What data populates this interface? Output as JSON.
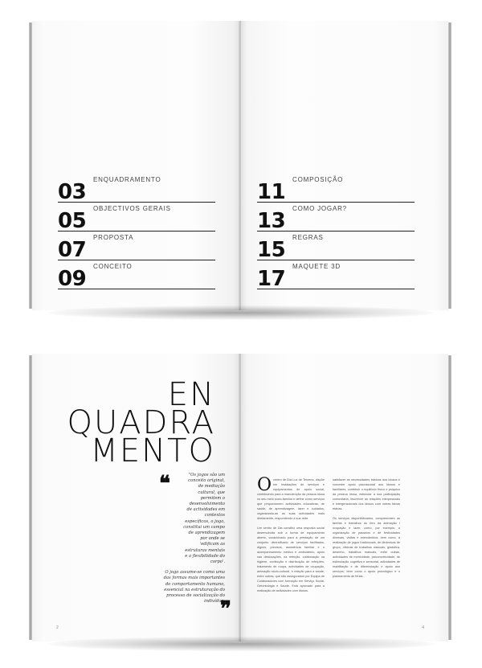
{
  "toc": {
    "left": [
      {
        "num": "03",
        "label": "ENQUADRAMENTO"
      },
      {
        "num": "05",
        "label": "OBJECTIVOS GERAIS"
      },
      {
        "num": "07",
        "label": "PROPOSTA"
      },
      {
        "num": "09",
        "label": "CONCEITO"
      }
    ],
    "right": [
      {
        "num": "11",
        "label": "COMPOSIÇÃO"
      },
      {
        "num": "13",
        "label": "COMO JOGAR?"
      },
      {
        "num": "15",
        "label": "REGRAS"
      },
      {
        "num": "17",
        "label": "MAQUETE 3D"
      }
    ]
  },
  "article": {
    "title_lines": [
      "EN",
      "QUADRA",
      "MENTO"
    ],
    "quote_paragraphs": [
      "\"Os jogos são um conceito original, de mediação cultural, que permitem o desenvolvimento de actividades em contextos específicos, o jogo, constitui um campo de aprendizagem por onde se 'edificam as estruturas mentais e a flexibilidade do corpo'.",
      "O jogo assume-se como uma das formas mais importantes do comportamento humano, essencial na estruturação do processo de socialização do indivíduo."
    ],
    "quote_open_mark": "❝",
    "quote_close_mark": "❞",
    "dropcap": "O",
    "col1": [
      "centro de Dia Luz de Tercena, dispõe em instalações de serviços e equipamentos de apoio social, contribuindo para a manutenção da pessoa idosa no seu meio sócio-familiar e define como serviços que proporcionem actividades educativas, de saúde, de aprendizagem, lazer e cuidados, organizando-as as suas actividades mais diretamente, respondendo à sua rede.",
      "Um centro de Dia constitui uma resposta social desenvolvida sob a forma de equipamento aberto, vocacionado para a prestação de um conjunto diversificado de serviços facilitados, dignos, precisos, assistência familiar e o acompanhamento médico e ambulatório, apoio nas deslocações, na refeição, colaboração na higiene, confecção e distribuição de refeições, tratamento de roupa, actividades de ocupação, animação sócio-cultural, e relação para a saúde, entre outras, que são assegurados por Equipa de Colaboradores com formação em Serviço Social, Gerontologia e Saúde. Está aprovado para a realização de actividades com idosos."
    ],
    "col2": [
      "satisfazer as necessidades básicas dos idosos e conceder apoio psicossocial aos idosos e familiares, contribuir o equilíbrio físico e psíquico da pessoa idosa, estimular a sua participação comunitária, favorecer as relações interpessoais e intergeracionais dos idosos com outras faixas etárias.",
      "Os serviços disponibilizados, compreendem as tarefas e trabalhos do foro da animação / ocupação e lazer, como, por exemplo, a organização de passeios e de festividades diversas, visitas e intercâmbios, bem como, a realização de jogos tradicionais, de dinâmicas de grupo, oficinas de trabalhos manuais, ginástica, desenho, trabalhos manuais, entre outras, actividades de motricidade, psicomotricidade, de estimulação cognitiva e sensorial, actividades de reabilitação e de diferenciação e apoio aos serviços, bem como o apoio psicológico e o planeamento de férias."
    ],
    "page_left": "2",
    "page_right": "4"
  }
}
